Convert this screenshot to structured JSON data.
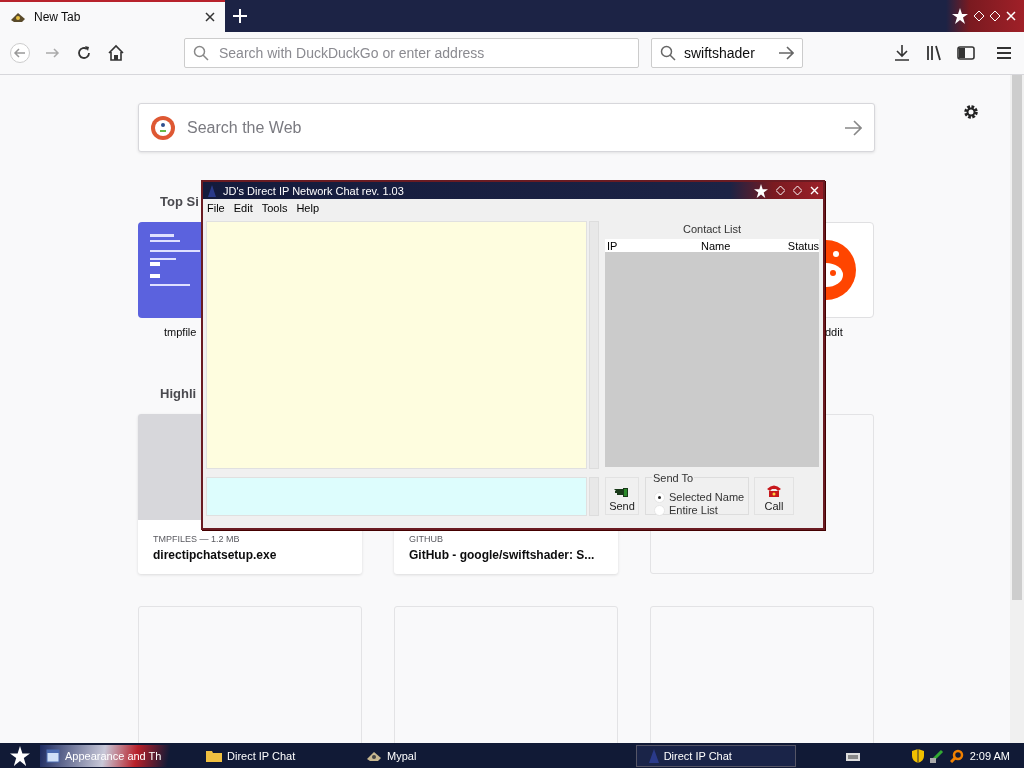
{
  "browser": {
    "tabs": [
      {
        "title": "New Tab",
        "selected": true
      }
    ],
    "address_bar": {
      "placeholder": "Search with DuckDuckGo or enter address"
    },
    "search_bar": {
      "value": "swiftshader"
    },
    "page": {
      "search": {
        "placeholder": "Search the Web"
      },
      "top_sites": {
        "heading": "Top Si",
        "tiles": [
          {
            "label": "tmpfile",
            "kind": "thumbnail"
          },
          {
            "label": "ddit",
            "kind": "logo"
          }
        ]
      },
      "highlights": {
        "heading": "Highli",
        "cards": [
          {
            "kind": "file",
            "source": "TMPFILES — 1.2 MB",
            "title": "directipchatsetup.exe"
          },
          {
            "kind": "link",
            "source": "GITHUB",
            "title": "GitHub - google/swiftshader: S..."
          },
          {
            "kind": "empty"
          },
          {
            "kind": "empty"
          },
          {
            "kind": "empty"
          },
          {
            "kind": "empty"
          }
        ]
      }
    }
  },
  "chat_window": {
    "title": "JD's Direct IP Network Chat rev. 1.03",
    "menu": [
      "File",
      "Edit",
      "Tools",
      "Help"
    ],
    "contact_list": {
      "label": "Contact List",
      "columns": [
        "IP",
        "Name",
        "Status"
      ]
    },
    "send_button": "Send",
    "send_to": {
      "label": "Send To",
      "options": [
        {
          "label": "Selected Name",
          "selected": true
        },
        {
          "label": "Entire List",
          "selected": false
        }
      ]
    },
    "call_button": "Call"
  },
  "taskbar": {
    "items": [
      {
        "label": "Appearance and Th",
        "selected": false,
        "kind": "window"
      },
      {
        "label": "Direct IP Chat",
        "selected": false,
        "kind": "folder"
      },
      {
        "label": "Mypal",
        "selected": false,
        "kind": "app"
      },
      {
        "label": "Direct IP Chat",
        "selected": true,
        "kind": "chat"
      }
    ],
    "clock": "2:09 AM"
  }
}
